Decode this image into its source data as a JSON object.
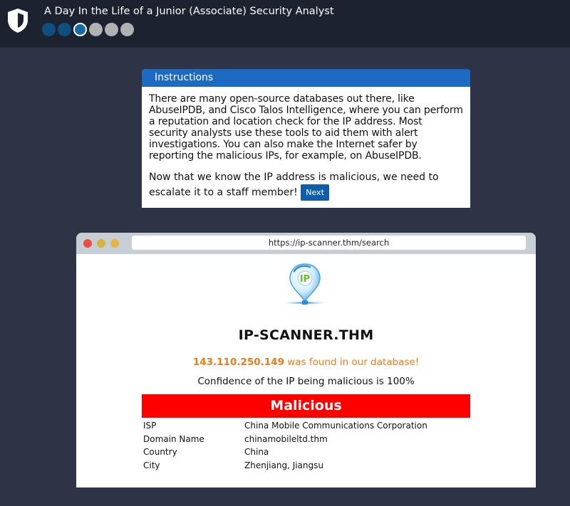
{
  "header": {
    "title": "A Day In the Life of a Junior (Associate) Security Analyst",
    "steps": [
      "done",
      "done",
      "current",
      "todo",
      "todo",
      "todo"
    ]
  },
  "instructions": {
    "heading": "Instructions",
    "paragraph1": "There are many open-source databases out there, like AbuseIPDB, and Cisco Talos Intelligence, where you can perform a reputation and location check for the IP address. Most security analysts use these tools to aid them with alert investigations. You can also make the Internet safer by reporting the malicious IPs, for example, on AbuseIPDB.",
    "paragraph2": "Now that we know the IP address is malicious, we need to escalate it to a staff member!",
    "next_label": "Next"
  },
  "browser": {
    "url": "https://ip-scanner.thm/search"
  },
  "scanner": {
    "logo_text": "IP",
    "site_title": "IP-SCANNER.THM",
    "ip_address": "143.110.250.149",
    "found_text": " was found in our database!",
    "confidence_text": "Confidence of the IP being malicious is 100%",
    "verdict": "Malicious",
    "details": [
      {
        "key": "ISP",
        "value": "China Mobile Communications Corporation"
      },
      {
        "key": "Domain Name",
        "value": "chinamobileltd.thm"
      },
      {
        "key": "Country",
        "value": "China"
      },
      {
        "key": "City",
        "value": "Zhenjiang, Jiangsu"
      }
    ]
  },
  "colors": {
    "verdict_bg": "#ff0000",
    "found_text": "#ef7a12",
    "header_bg": "#1d2231",
    "page_bg": "#2e3446",
    "instructions_header": "#1d6ac2"
  }
}
